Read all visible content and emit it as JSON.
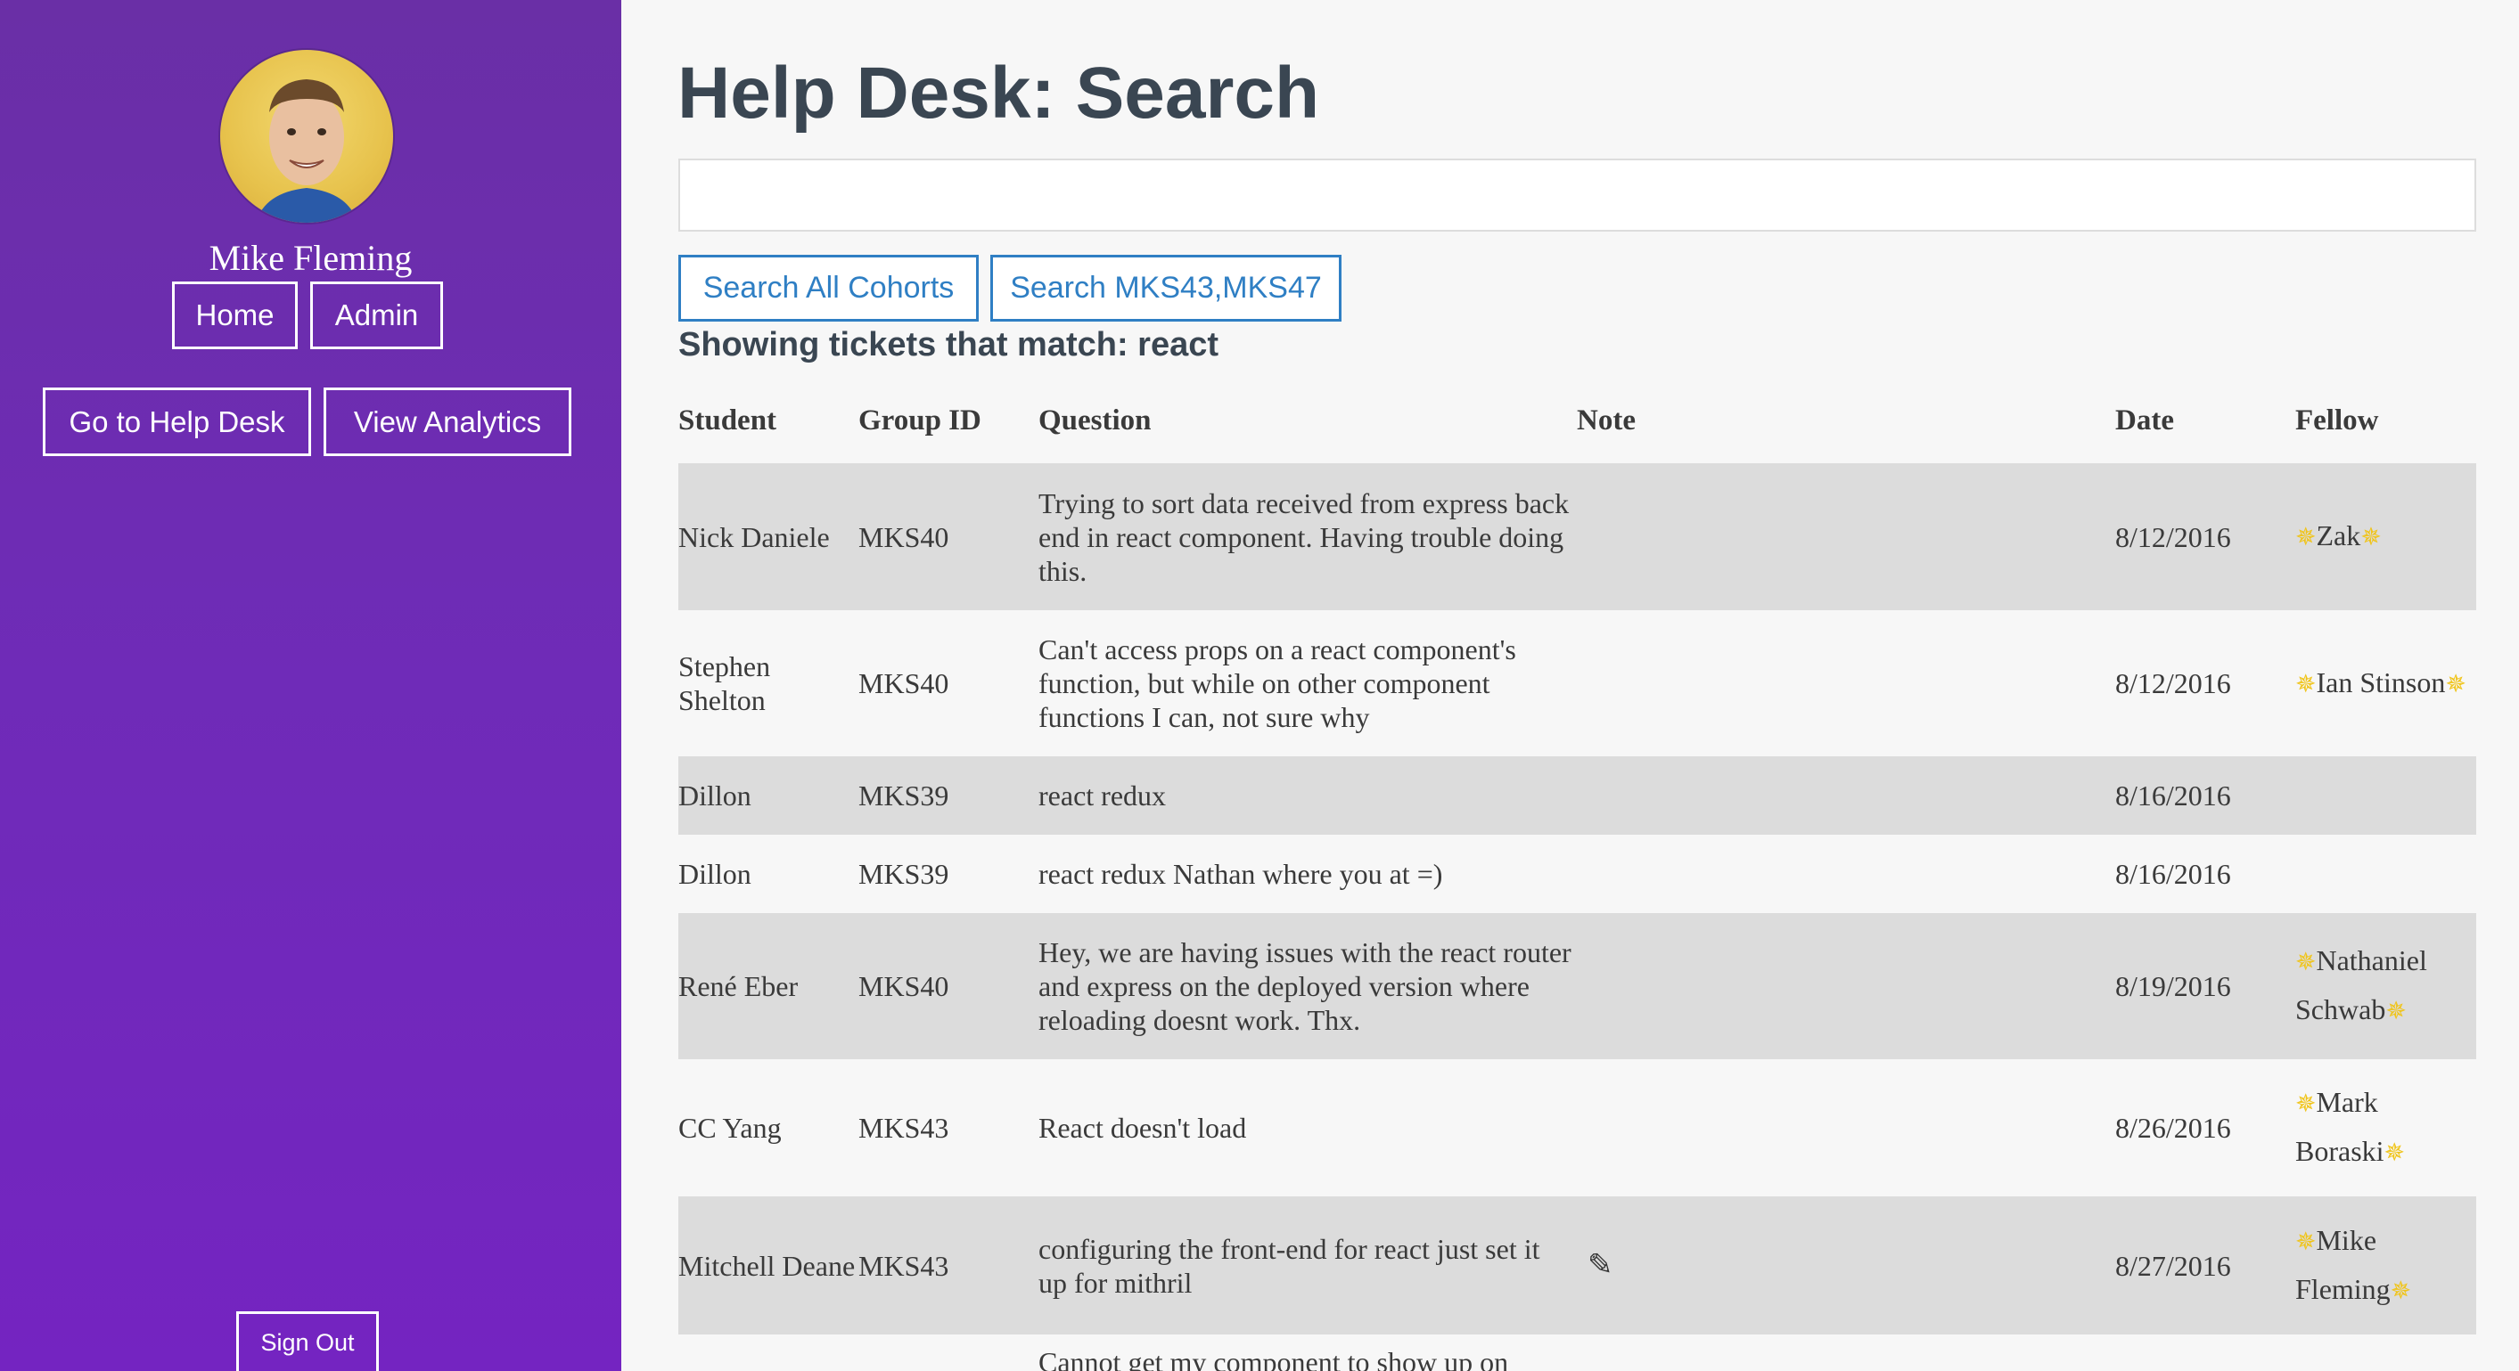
{
  "sidebar": {
    "user_name": "Mike Fleming",
    "nav": {
      "home": "Home",
      "admin": "Admin"
    },
    "actions": {
      "help_desk": "Go to Help Desk",
      "analytics": "View Analytics"
    },
    "sign_out": "Sign Out"
  },
  "main": {
    "title": "Help Desk: Search",
    "search": {
      "value": "",
      "placeholder": ""
    },
    "buttons": {
      "search_all": "Search All Cohorts",
      "search_cohorts": "Search MKS43,MKS47"
    },
    "match_prefix": "Showing tickets that match: ",
    "match_term": "react"
  },
  "table": {
    "headers": {
      "student": "Student",
      "group": "Group ID",
      "question": "Question",
      "note": "Note",
      "date": "Date",
      "fellow": "Fellow"
    },
    "rows": [
      {
        "student": "Nick Daniele",
        "group": "MKS40",
        "question": "Trying to sort data received from express back end in react component. Having trouble doing this.",
        "date": "8/12/2016",
        "fellow": "Zak"
      },
      {
        "student": "Stephen Shelton",
        "group": "MKS40",
        "question": "Can't access props on a react component's function, but while on other component functions I can, not sure why",
        "date": "8/12/2016",
        "fellow": "Ian Stinson"
      },
      {
        "student": "Dillon",
        "group": "MKS39",
        "question": "react redux",
        "date": "8/16/2016",
        "fellow": ""
      },
      {
        "student": "Dillon",
        "group": "MKS39",
        "question": "react redux Nathan where you at =)",
        "date": "8/16/2016",
        "fellow": ""
      },
      {
        "student": "René Eber",
        "group": "MKS40",
        "question": "Hey, we are having issues with the react router and express on the deployed version where reloading doesnt work. Thx.",
        "date": "8/19/2016",
        "fellow": "Nathaniel Schwab"
      },
      {
        "student": "CC Yang",
        "group": "MKS43",
        "question": "React doesn't load",
        "date": "8/26/2016",
        "fellow": "Mark Boraski"
      },
      {
        "student": "Mitchell Deane",
        "group": "MKS43",
        "question": "configuring the front-end for react just set it up for mithril",
        "date": "8/27/2016",
        "fellow": "Mike Fleming"
      },
      {
        "student": "",
        "group": "",
        "question": "Cannot get my component to show up on",
        "date": "",
        "fellow": ""
      }
    ]
  },
  "icons": {
    "star": "star-icon",
    "note": "pencil-icon"
  },
  "colors": {
    "sidebar": "#6f2bb8",
    "accent": "#2f7fc4",
    "row_shade": "#dcdcdc",
    "star": "#f0c419"
  }
}
